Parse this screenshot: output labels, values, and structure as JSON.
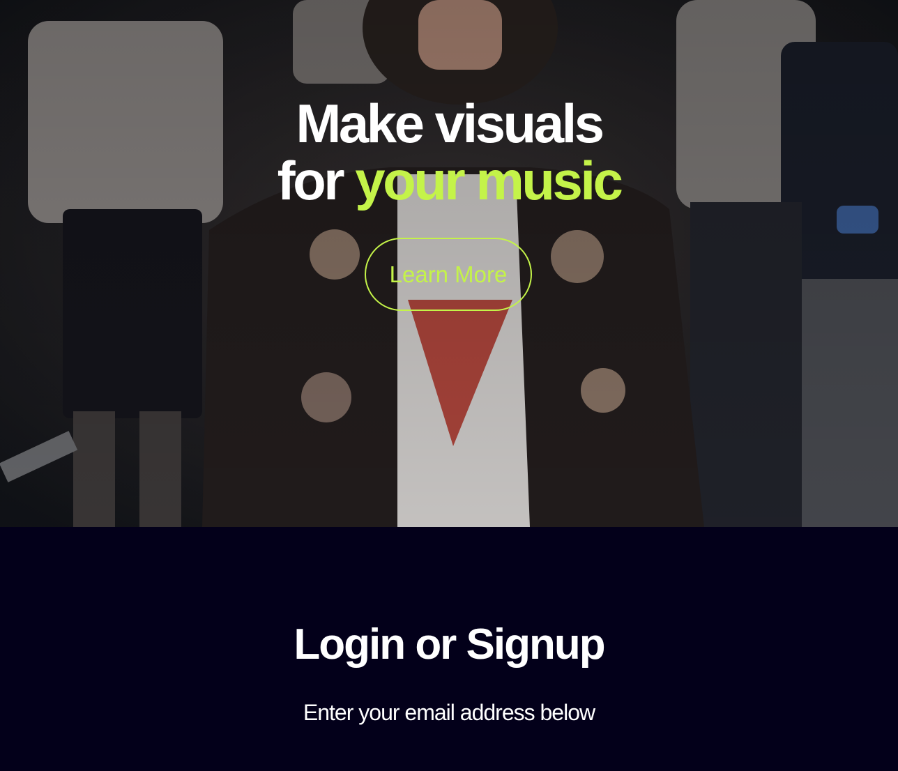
{
  "hero": {
    "background_image": "crowd-street-photo",
    "headline_line1": "Make visuals",
    "headline_for": "for ",
    "headline_accent": "your music",
    "cta_label": "Learn More"
  },
  "login": {
    "title": "Login or Signup",
    "subtitle": "Enter your email address below"
  },
  "colors": {
    "accent": "#c4f349",
    "background": "#03001a",
    "text": "#ffffff"
  }
}
